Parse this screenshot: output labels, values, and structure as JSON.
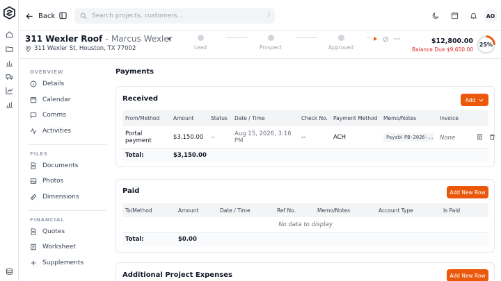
{
  "topbar": {
    "back_label": "Back",
    "search_placeholder": "Search projects, customers...",
    "search_shortcut": "/",
    "avatar_initials": "AO"
  },
  "project": {
    "title": "311 Wexler Roof",
    "separator": "-",
    "customer": "Marcus Wexler",
    "address": "311 Wexler St, Houston, TX 77002",
    "stages": [
      "Lead",
      "Prospect",
      "Approved"
    ],
    "total_price": "$12,800.00",
    "balance_due": "Balance Due $9,650.00",
    "progress_label": "25%",
    "progress_value": 25,
    "accent_color": "#ea580c"
  },
  "nav": {
    "overview_title": "OVERVIEW",
    "overview": [
      "Details",
      "Calendar",
      "Comms",
      "Activities"
    ],
    "files_title": "FILES",
    "files": [
      "Documents",
      "Photos",
      "Dimensions"
    ],
    "financial_title": "FINANCIAL",
    "financial": [
      "Quotes",
      "Worksheet",
      "Supplements"
    ]
  },
  "main": {
    "page_title": "Payments",
    "received": {
      "title": "Received",
      "add_label": "Add",
      "columns": [
        "From/Method",
        "Amount",
        "Status",
        "Date / Time",
        "Check No.",
        "Payment Method",
        "Memo/Notes",
        "Invoice"
      ],
      "rows": [
        {
          "from": "Portal payment",
          "amount": "$3,150.00",
          "status": "--",
          "datetime": "Aug 15, 2026, 3:16 PM",
          "check": "--",
          "method": "ACH",
          "memo_prefix": "Payabl",
          "memo_code": "PB-2026-...",
          "invoice": "None"
        }
      ],
      "total_label": "Total:",
      "total_amount": "$3,150.00"
    },
    "paid": {
      "title": "Paid",
      "add_label": "Add New Row",
      "columns": [
        "To/Method",
        "Amount",
        "Date / Time",
        "Ref No.",
        "Memo/Notes",
        "Account Type",
        "Is Paid"
      ],
      "empty_text": "No data to display",
      "total_label": "Total:",
      "total_amount": "$0.00"
    },
    "expenses": {
      "title": "Additional Project Expenses",
      "add_label": "Add New Row"
    }
  }
}
